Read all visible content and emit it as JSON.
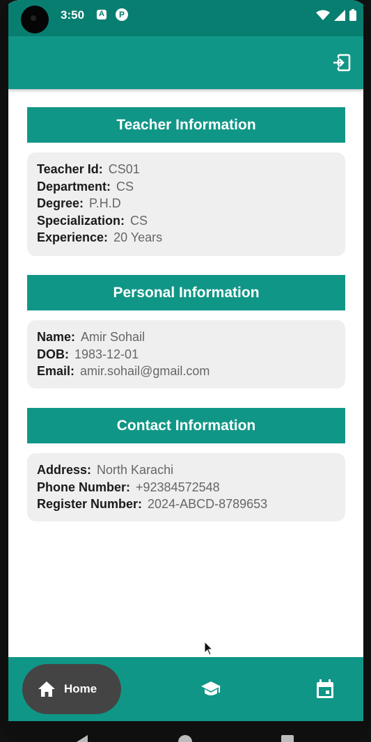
{
  "status_bar": {
    "time": "3:50"
  },
  "sections": {
    "teacher": {
      "title": "Teacher Information",
      "rows": [
        {
          "label": "Teacher Id:",
          "value": "CS01"
        },
        {
          "label": "Department:",
          "value": "CS"
        },
        {
          "label": "Degree:",
          "value": "P.H.D"
        },
        {
          "label": "Specialization:",
          "value": "CS"
        },
        {
          "label": "Experience:",
          "value": "20 Years"
        }
      ]
    },
    "personal": {
      "title": "Personal Information",
      "rows": [
        {
          "label": "Name:",
          "value": "Amir Sohail"
        },
        {
          "label": "DOB:",
          "value": "1983-12-01"
        },
        {
          "label": "Email:",
          "value": "amir.sohail@gmail.com"
        }
      ]
    },
    "contact": {
      "title": "Contact Information",
      "rows": [
        {
          "label": "Address:",
          "value": "North Karachi"
        },
        {
          "label": "Phone Number:",
          "value": "+92384572548"
        },
        {
          "label": "Register Number:",
          "value": "2024-ABCD-8789653"
        }
      ]
    }
  },
  "bottom_nav": {
    "home_label": "Home",
    "items": [
      "home-icon",
      "graduation-cap-icon",
      "calendar-icon"
    ]
  },
  "colors": {
    "primary": "#109686",
    "status_bar": "#087e71",
    "card_bg": "#efefef",
    "nav_selected": "#444444"
  }
}
